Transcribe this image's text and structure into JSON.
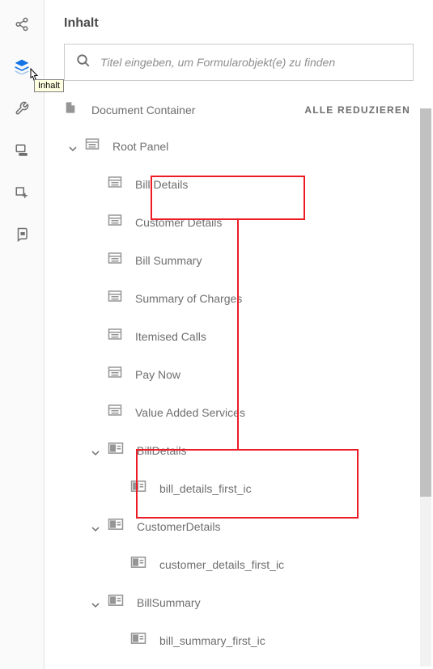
{
  "panel": {
    "title": "Inhalt",
    "tooltip": "Inhalt"
  },
  "search": {
    "placeholder": "Titel eingeben, um Formularobjekt(e) zu finden"
  },
  "treeHeader": {
    "title": "Document Container",
    "collapseAll": "ALLE REDUZIEREN"
  },
  "tree": {
    "root": "Root Panel",
    "items": [
      "Bill Details",
      "Customer Details",
      "Bill Summary",
      "Summary of Charges",
      "Itemised Calls",
      "Pay Now",
      "Value Added Services"
    ],
    "billDetails": {
      "label": "BillDetails",
      "child": "bill_details_first_ic"
    },
    "customerDetails": {
      "label": "CustomerDetails",
      "child": "customer_details_first_ic"
    },
    "billSummary": {
      "label": "BillSummary",
      "child": "bill_summary_first_ic"
    }
  }
}
